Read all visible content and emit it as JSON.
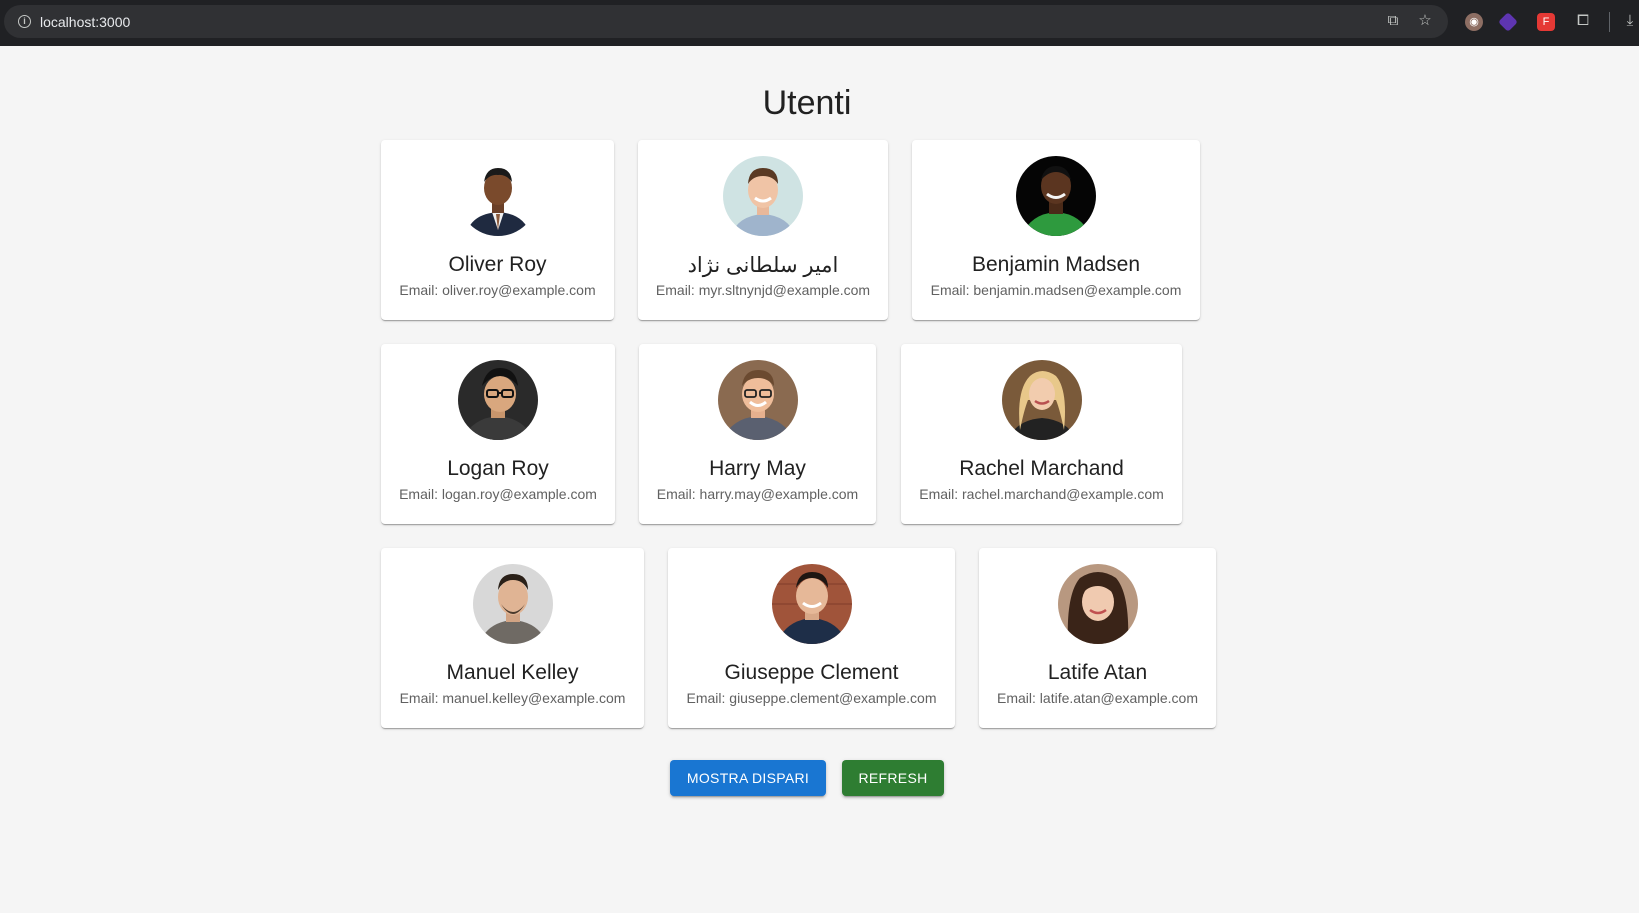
{
  "browser": {
    "url": "localhost:3000"
  },
  "page": {
    "title": "Utenti"
  },
  "users": [
    {
      "name": "Oliver Roy",
      "email": "Email: oliver.roy@example.com"
    },
    {
      "name": "امیر سلطانی نژاد",
      "email": "Email: myr.sltnynjd@example.com"
    },
    {
      "name": "Benjamin Madsen",
      "email": "Email: benjamin.madsen@example.com"
    },
    {
      "name": "Logan Roy",
      "email": "Email: logan.roy@example.com"
    },
    {
      "name": "Harry May",
      "email": "Email: harry.may@example.com"
    },
    {
      "name": "Rachel Marchand",
      "email": "Email: rachel.marchand@example.com"
    },
    {
      "name": "Manuel Kelley",
      "email": "Email: manuel.kelley@example.com"
    },
    {
      "name": "Giuseppe Clement",
      "email": "Email: giuseppe.clement@example.com"
    },
    {
      "name": "Latife Atan",
      "email": "Email: latife.atan@example.com"
    }
  ],
  "buttons": {
    "show_odd": "MOSTRA DISPARI",
    "refresh": "REFRESH"
  },
  "colors": {
    "primary_button": "#1976d2",
    "refresh_button": "#2e7d32",
    "background": "#f5f5f5"
  }
}
